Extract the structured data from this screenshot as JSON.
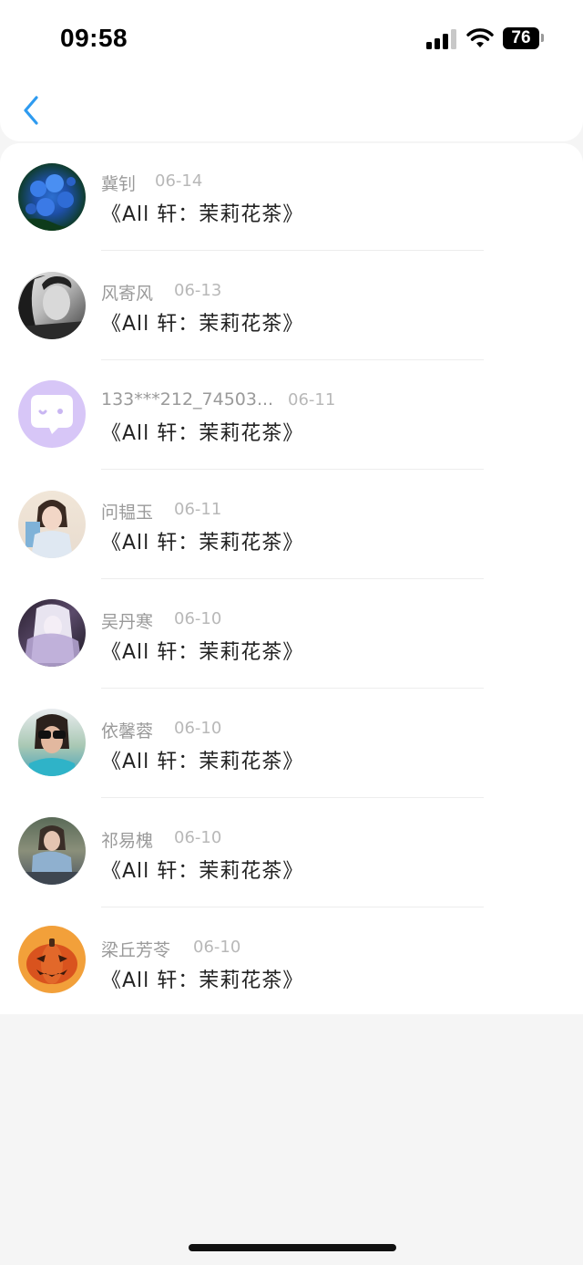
{
  "status_bar": {
    "time": "09:58",
    "battery": "76"
  },
  "nav": {
    "back_icon": "chevron-left-icon"
  },
  "items": [
    {
      "name": "冀钊",
      "date": "06-14",
      "title": "《All 轩：茉莉花茶》",
      "avatar": "blue-flowers"
    },
    {
      "name": "风寄风",
      "date": "06-13",
      "title": "《All 轩：茉莉花茶》",
      "avatar": "woman-portrait-bw"
    },
    {
      "name": "133***212_74503...",
      "date": "06-11",
      "title": "《All 轩：茉莉花茶》",
      "avatar": "chat-bubble-default"
    },
    {
      "name": "问韫玉",
      "date": "06-11",
      "title": "《All 轩：茉莉花茶》",
      "avatar": "woman-holding-book"
    },
    {
      "name": "吴丹寒",
      "date": "06-10",
      "title": "《All 轩：茉莉花茶》",
      "avatar": "anime-white-hair"
    },
    {
      "name": "依馨蓉",
      "date": "06-10",
      "title": "《All 轩：茉莉花茶》",
      "avatar": "woman-sunglasses"
    },
    {
      "name": "祁易槐",
      "date": "06-10",
      "title": "《All 轩：茉莉花茶》",
      "avatar": "woman-sitting-outdoor"
    },
    {
      "name": "梁丘芳苓",
      "date": "06-10",
      "title": "《All 轩：茉莉花茶》",
      "avatar": "pumpkin-face"
    }
  ],
  "colors": {
    "accent": "#2e9bf0",
    "name": "#9a9a9a",
    "date": "#b8b8b8",
    "title": "#222222"
  }
}
